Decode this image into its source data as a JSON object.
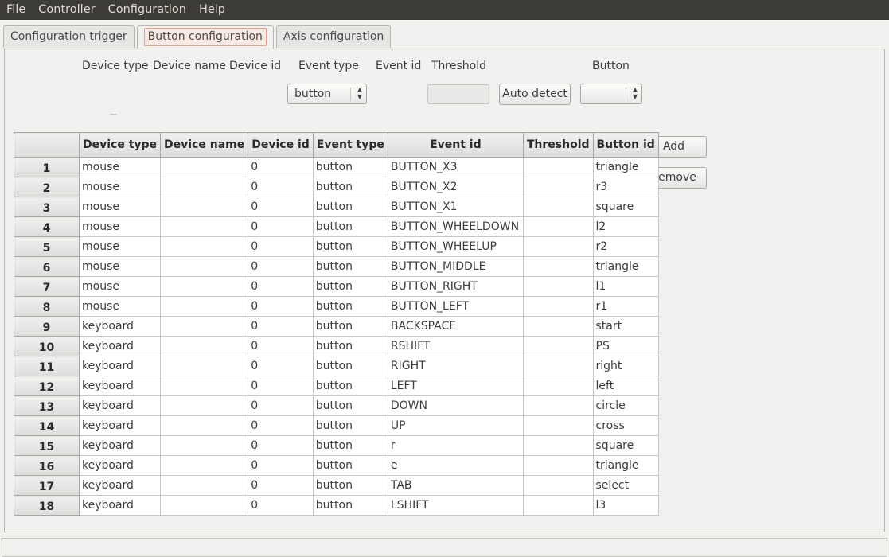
{
  "menubar": [
    "File",
    "Controller",
    "Configuration",
    "Help"
  ],
  "tabs": [
    "Configuration trigger",
    "Button configuration",
    "Axis configuration"
  ],
  "form": {
    "labels": {
      "device_type": "Device type",
      "device_name": "Device name",
      "device_id": "Device id",
      "event_type": "Event type",
      "event_id": "Event id",
      "threshold": "Threshold",
      "button": "Button"
    },
    "event_type_value": "button",
    "threshold_value": "",
    "button_value": "",
    "auto_detect_label": "Auto detect"
  },
  "actions": {
    "add": "Add",
    "remove": "Remove"
  },
  "table": {
    "headers": [
      "Device type",
      "Device name",
      "Device id",
      "Event type",
      "Event id",
      "Threshold",
      "Button id"
    ],
    "rows": [
      [
        "1",
        "mouse",
        "",
        "0",
        "button",
        "BUTTON_X3",
        "",
        "triangle"
      ],
      [
        "2",
        "mouse",
        "",
        "0",
        "button",
        "BUTTON_X2",
        "",
        "r3"
      ],
      [
        "3",
        "mouse",
        "",
        "0",
        "button",
        "BUTTON_X1",
        "",
        "square"
      ],
      [
        "4",
        "mouse",
        "",
        "0",
        "button",
        "BUTTON_WHEELDOWN",
        "",
        "l2"
      ],
      [
        "5",
        "mouse",
        "",
        "0",
        "button",
        "BUTTON_WHEELUP",
        "",
        "r2"
      ],
      [
        "6",
        "mouse",
        "",
        "0",
        "button",
        "BUTTON_MIDDLE",
        "",
        "triangle"
      ],
      [
        "7",
        "mouse",
        "",
        "0",
        "button",
        "BUTTON_RIGHT",
        "",
        "l1"
      ],
      [
        "8",
        "mouse",
        "",
        "0",
        "button",
        "BUTTON_LEFT",
        "",
        "r1"
      ],
      [
        "9",
        "keyboard",
        "",
        "0",
        "button",
        "BACKSPACE",
        "",
        "start"
      ],
      [
        "10",
        "keyboard",
        "",
        "0",
        "button",
        "RSHIFT",
        "",
        "PS"
      ],
      [
        "11",
        "keyboard",
        "",
        "0",
        "button",
        "RIGHT",
        "",
        "right"
      ],
      [
        "12",
        "keyboard",
        "",
        "0",
        "button",
        "LEFT",
        "",
        "left"
      ],
      [
        "13",
        "keyboard",
        "",
        "0",
        "button",
        "DOWN",
        "",
        "circle"
      ],
      [
        "14",
        "keyboard",
        "",
        "0",
        "button",
        "UP",
        "",
        "cross"
      ],
      [
        "15",
        "keyboard",
        "",
        "0",
        "button",
        "r",
        "",
        "square"
      ],
      [
        "16",
        "keyboard",
        "",
        "0",
        "button",
        "e",
        "",
        "triangle"
      ],
      [
        "17",
        "keyboard",
        "",
        "0",
        "button",
        "TAB",
        "",
        "select"
      ],
      [
        "18",
        "keyboard",
        "",
        "0",
        "button",
        "LSHIFT",
        "",
        "l3"
      ]
    ]
  },
  "icons": {
    "combo_arrow": "spin-arrows-icon"
  },
  "colors": {
    "menubar_bg": "#3c3b37",
    "active_tab_highlight": "#fbe9e3"
  }
}
